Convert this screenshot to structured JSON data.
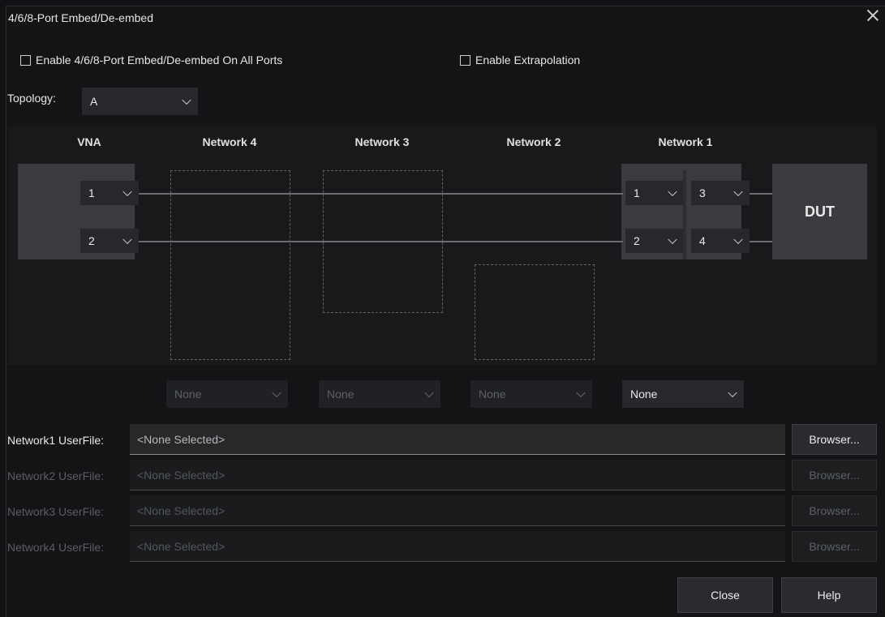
{
  "window": {
    "title": "4/6/8-Port Embed/De-embed"
  },
  "options": {
    "enable_all_ports": {
      "label": "Enable 4/6/8-Port Embed/De-embed On All Ports",
      "checked": false
    },
    "enable_extrapolation": {
      "label": "Enable Extrapolation",
      "checked": false
    }
  },
  "topology": {
    "label": "Topology:",
    "value": "A"
  },
  "diagram": {
    "headers": {
      "vna": "VNA",
      "network4": "Network 4",
      "network3": "Network 3",
      "network2": "Network 2",
      "network1": "Network 1"
    },
    "vna_ports": [
      "1",
      "2"
    ],
    "network1_left_ports": [
      "1",
      "2"
    ],
    "network1_right_ports": [
      "3",
      "4"
    ],
    "dut_label": "DUT"
  },
  "network_types": {
    "network4": "None",
    "network3": "None",
    "network2": "None",
    "network1": "None"
  },
  "user_files": [
    {
      "label": "Network1 UserFile:",
      "value": "<None Selected>",
      "button": "Browser...",
      "enabled": true
    },
    {
      "label": "Network2 UserFile:",
      "value": "<None Selected>",
      "button": "Browser...",
      "enabled": false
    },
    {
      "label": "Network3 UserFile:",
      "value": "<None Selected>",
      "button": "Browser...",
      "enabled": false
    },
    {
      "label": "Network4 UserFile:",
      "value": "<None Selected>",
      "button": "Browser...",
      "enabled": false
    }
  ],
  "footer": {
    "close_label": "Close",
    "help_label": "Help"
  },
  "colors": {
    "background": "#131416",
    "panel": "#17191b",
    "block": "#3a3b3e",
    "control": "#26282c"
  }
}
